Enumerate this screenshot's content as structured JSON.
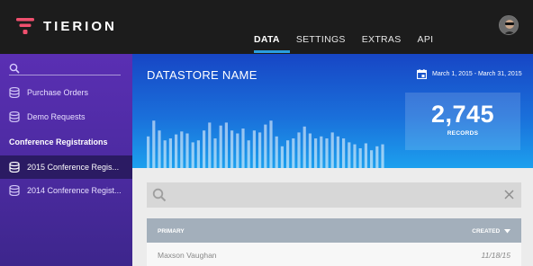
{
  "app": {
    "name": "TIERION",
    "brand_color": "#f0506e"
  },
  "nav": {
    "items": [
      {
        "label": "DATA",
        "active": true
      },
      {
        "label": "SETTINGS",
        "active": false
      },
      {
        "label": "EXTRAS",
        "active": false
      },
      {
        "label": "API",
        "active": false
      }
    ]
  },
  "sidebar": {
    "search_placeholder": "",
    "items": [
      {
        "label": "Purchase Orders",
        "icon": "database-icon"
      },
      {
        "label": "Demo Requests",
        "icon": "database-icon"
      }
    ],
    "section_header": "Conference Registrations",
    "section_items": [
      {
        "label": "2015 Conference Regis...",
        "icon": "database-icon",
        "active": true
      },
      {
        "label": "2014 Conference Regist...",
        "icon": "database-icon",
        "active": false
      }
    ]
  },
  "datastore": {
    "title": "DATASTORE NAME",
    "date_range": "March 1, 2015 - March 31, 2015",
    "records_count": "2,745",
    "records_label": "RECORDS",
    "activity_bars": [
      32,
      48,
      38,
      28,
      30,
      34,
      37,
      35,
      26,
      28,
      38,
      46,
      30,
      43,
      46,
      38,
      35,
      40,
      28,
      38,
      36,
      44,
      48,
      32,
      22,
      28,
      30,
      36,
      42,
      35,
      30,
      32,
      30,
      36,
      32,
      30,
      26,
      24,
      20,
      25,
      18,
      22,
      24
    ]
  },
  "records_search": {
    "placeholder": ""
  },
  "table": {
    "columns": {
      "primary": "PRIMARY",
      "created": "CREATED"
    },
    "rows": [
      {
        "primary": "Maxson Vaughan",
        "created": "11/18/15"
      }
    ]
  }
}
